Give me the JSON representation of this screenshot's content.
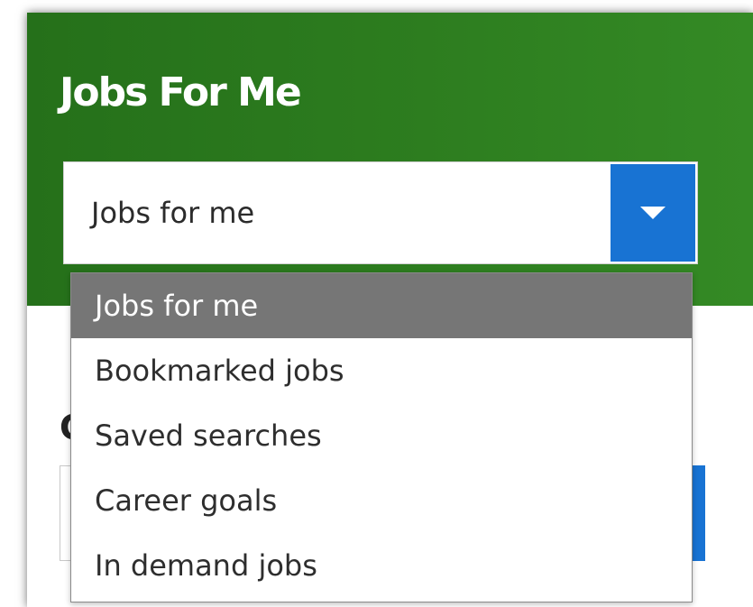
{
  "header": {
    "title": "Jobs For Me",
    "background_color": "#2d7d1f"
  },
  "view_select": {
    "value": "Jobs for me",
    "toggle_icon": "caret-down-icon",
    "toggle_color": "#1873d3"
  },
  "dropdown": {
    "options": [
      {
        "label": "Jobs for me",
        "selected": true
      },
      {
        "label": "Bookmarked jobs",
        "selected": false
      },
      {
        "label": "Saved searches",
        "selected": false
      },
      {
        "label": "Career goals",
        "selected": false
      },
      {
        "label": "In demand jobs",
        "selected": false
      }
    ],
    "selected_color": "#767676"
  },
  "behind": {
    "heading_fragment": "C"
  }
}
